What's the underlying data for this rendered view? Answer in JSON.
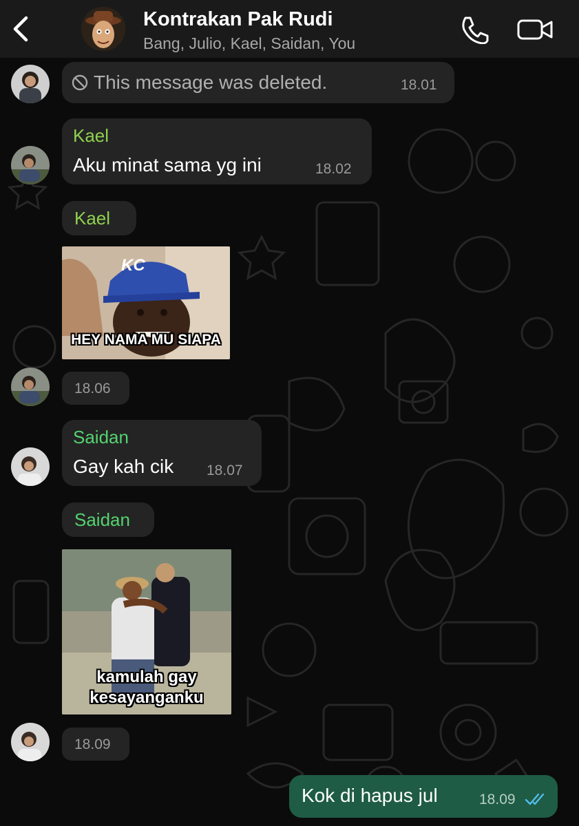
{
  "header": {
    "title": "Kontrakan Pak Rudi",
    "subtitle": "Bang, Julio, Kael, Saidan, You",
    "back_icon": "chevron-left-icon",
    "call_icon": "phone-icon",
    "video_icon": "video-camera-icon"
  },
  "colors": {
    "header_bg": "#1a1a1a",
    "chat_bg": "#0b0b0b",
    "incoming_bubble": "#242424",
    "outgoing_bubble": "#1f5c45",
    "kael_name": "#8fd14f",
    "saidan_name": "#54d36f",
    "read_ticks": "#53bdeb"
  },
  "messages": [
    {
      "type": "deleted",
      "text": "This message was deleted.",
      "time": "18.01",
      "icon": "blocked-icon"
    },
    {
      "type": "text",
      "sender": "Kael",
      "text": "Aku minat sama yg ini",
      "time": "18.02"
    },
    {
      "type": "sticker",
      "sender": "Kael",
      "caption": "HEY NAMA MU SIAPA",
      "cap_text": "KC",
      "time": "18.06"
    },
    {
      "type": "text",
      "sender": "Saidan",
      "text": "Gay kah cik",
      "time": "18.07"
    },
    {
      "type": "sticker",
      "sender": "Saidan",
      "caption_line1": "kamulah gay",
      "caption_line2": "kesayanganku",
      "time": "18.09"
    },
    {
      "type": "outgoing",
      "text": "Kok di hapus jul",
      "time": "18.09",
      "status": "read"
    }
  ]
}
